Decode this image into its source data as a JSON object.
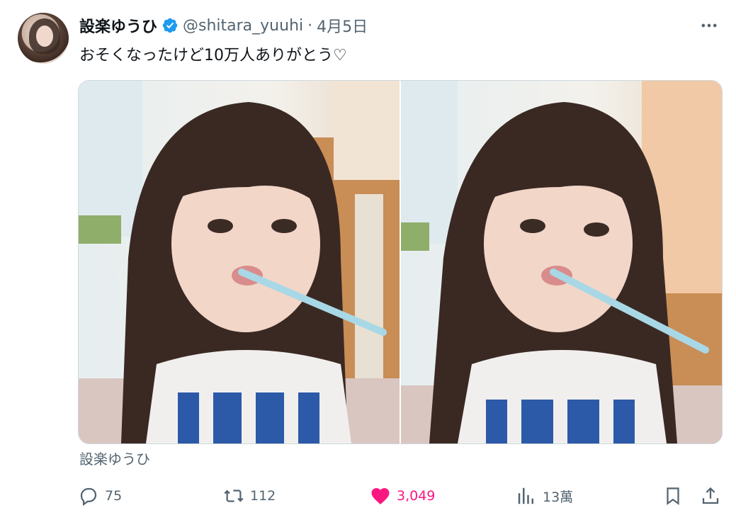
{
  "tweet": {
    "display_name": "設楽ゆうひ",
    "handle": "@shitara_yuuhi",
    "separator": "·",
    "date": "4月5日",
    "text": "おそくなったけど10万人ありがとう♡",
    "media_caption": "設楽ゆうひ"
  },
  "actions": {
    "replies": "75",
    "retweets": "112",
    "likes": "3,049",
    "views": "13萬"
  },
  "colors": {
    "verified": "#1d9bf0",
    "like": "#f91880",
    "secondary": "#536471"
  },
  "icons": [
    "verified-badge-icon",
    "more-icon",
    "reply-icon",
    "retweet-icon",
    "heart-icon",
    "views-icon",
    "bookmark-icon",
    "share-icon"
  ]
}
